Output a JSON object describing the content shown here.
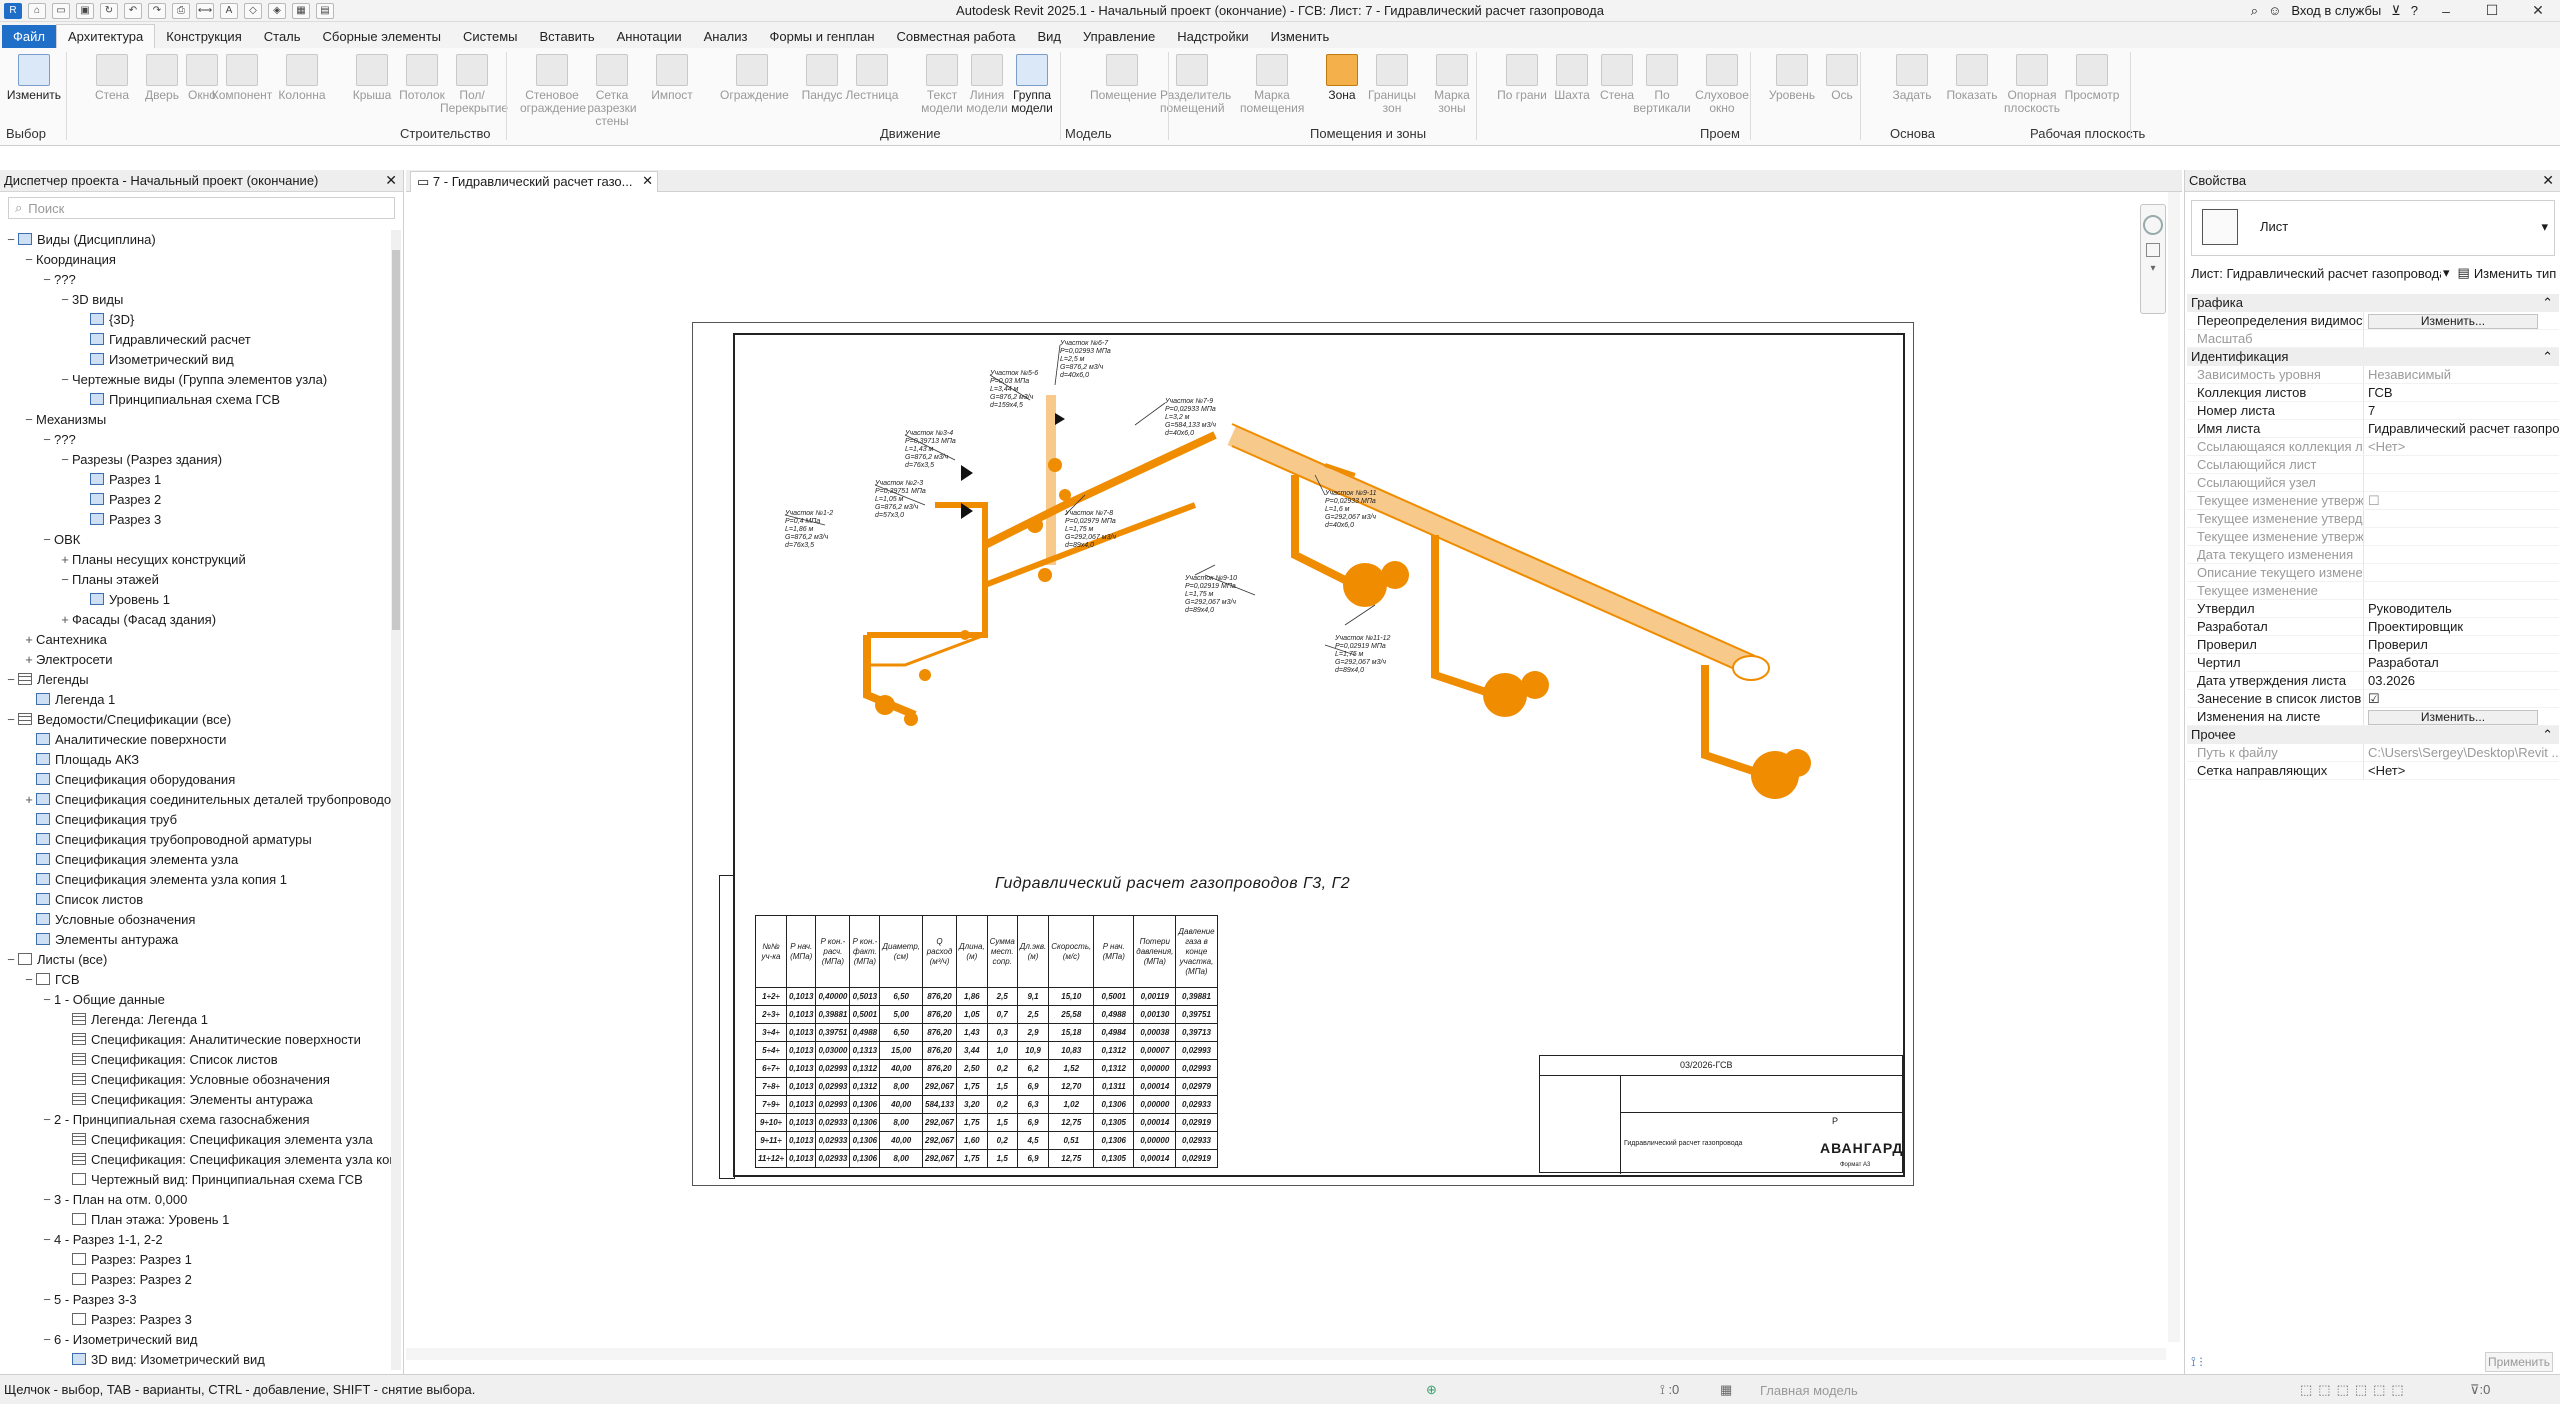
{
  "window": {
    "title": "Autodesk Revit 2025.1 - Начальный проект (окончание) - ГСВ: Лист: 7 - Гидравлический расчет газопровода"
  },
  "titlebar_right": {
    "login": "Вход в службы",
    "min": "–",
    "max": "☐",
    "close": "✕"
  },
  "tabs": [
    "Файл",
    "Архитектура",
    "Конструкция",
    "Сталь",
    "Сборные элементы",
    "Системы",
    "Вставить",
    "Аннотации",
    "Анализ",
    "Формы и генплан",
    "Совместная работа",
    "Вид",
    "Управление",
    "Надстройки",
    "Изменить"
  ],
  "ribbon": {
    "tools": [
      {
        "label": "Изменить",
        "enabled": true
      },
      {
        "label": "Стена",
        "enabled": false
      },
      {
        "label": "Дверь",
        "enabled": false
      },
      {
        "label": "Окно",
        "enabled": false
      },
      {
        "label": "Компонент",
        "enabled": false
      },
      {
        "label": "Колонна",
        "enabled": false
      },
      {
        "label": "Крыша",
        "enabled": false
      },
      {
        "label": "Потолок",
        "enabled": false
      },
      {
        "label": "Пол/Перекрытие",
        "enabled": false
      },
      {
        "label": "Стеновое ограждение",
        "enabled": false
      },
      {
        "label": "Сетка разрезки стены",
        "enabled": false
      },
      {
        "label": "Импост",
        "enabled": false
      },
      {
        "label": "Ограждение",
        "enabled": false
      },
      {
        "label": "Пандус",
        "enabled": false
      },
      {
        "label": "Лестница",
        "enabled": false
      },
      {
        "label": "Текст модели",
        "enabled": false
      },
      {
        "label": "Линия модели",
        "enabled": false
      },
      {
        "label": "Группа модели",
        "enabled": true
      },
      {
        "label": "Помещение",
        "enabled": false
      },
      {
        "label": "Разделитель помещений",
        "enabled": false
      },
      {
        "label": "Марка помещения",
        "enabled": false
      },
      {
        "label": "Зона",
        "enabled": true
      },
      {
        "label": "Границы зон",
        "enabled": false
      },
      {
        "label": "Марка зоны",
        "enabled": false
      },
      {
        "label": "По грани",
        "enabled": false
      },
      {
        "label": "Шахта",
        "enabled": false
      },
      {
        "label": "Стена",
        "enabled": false
      },
      {
        "label": "По вертикали",
        "enabled": false
      },
      {
        "label": "Слуховое окно",
        "enabled": false
      },
      {
        "label": "Уровень",
        "enabled": false
      },
      {
        "label": "Ось",
        "enabled": false
      },
      {
        "label": "Задать",
        "enabled": false
      },
      {
        "label": "Показать",
        "enabled": false
      },
      {
        "label": "Опорная плоскость",
        "enabled": false
      },
      {
        "label": "Просмотр",
        "enabled": false
      }
    ],
    "panels": [
      "Выбор",
      "Строительство",
      "Движение",
      "Модель",
      "Помещения и зоны",
      "Проем",
      "Основа",
      "Рабочая плоскость"
    ]
  },
  "project_browser": {
    "title": "Диспетчер проекта - Начальный проект (окончание)",
    "search_placeholder": "Поиск",
    "nodes": [
      {
        "t": "Виды (Дисциплина)",
        "l": 0,
        "e": "−",
        "i": "view"
      },
      {
        "t": "Координация",
        "l": 1,
        "e": "−",
        "i": ""
      },
      {
        "t": "???",
        "l": 2,
        "e": "−",
        "i": ""
      },
      {
        "t": "3D виды",
        "l": 3,
        "e": "−",
        "i": ""
      },
      {
        "t": "{3D}",
        "l": 4,
        "e": "",
        "i": "view"
      },
      {
        "t": "Гидравлический расчет",
        "l": 4,
        "e": "",
        "i": "view"
      },
      {
        "t": "Изометрический вид",
        "l": 4,
        "e": "",
        "i": "view"
      },
      {
        "t": "Чертежные виды (Группа элементов узла)",
        "l": 3,
        "e": "−",
        "i": ""
      },
      {
        "t": "Принципиальная схема ГСВ",
        "l": 4,
        "e": "",
        "i": "view"
      },
      {
        "t": "Механизмы",
        "l": 1,
        "e": "−",
        "i": ""
      },
      {
        "t": "???",
        "l": 2,
        "e": "−",
        "i": ""
      },
      {
        "t": "Разрезы (Разрез здания)",
        "l": 3,
        "e": "−",
        "i": ""
      },
      {
        "t": "Разрез 1",
        "l": 4,
        "e": "",
        "i": "view"
      },
      {
        "t": "Разрез 2",
        "l": 4,
        "e": "",
        "i": "view"
      },
      {
        "t": "Разрез 3",
        "l": 4,
        "e": "",
        "i": "view"
      },
      {
        "t": "ОВК",
        "l": 2,
        "e": "−",
        "i": ""
      },
      {
        "t": "Планы несущих конструкций",
        "l": 3,
        "e": "+",
        "i": ""
      },
      {
        "t": "Планы этажей",
        "l": 3,
        "e": "−",
        "i": ""
      },
      {
        "t": "Уровень 1",
        "l": 4,
        "e": "",
        "i": "view"
      },
      {
        "t": "Фасады (Фасад здания)",
        "l": 3,
        "e": "+",
        "i": ""
      },
      {
        "t": "Сантехника",
        "l": 1,
        "e": "+",
        "i": ""
      },
      {
        "t": "Электросети",
        "l": 1,
        "e": "+",
        "i": ""
      },
      {
        "t": "Легенды",
        "l": 0,
        "e": "−",
        "i": "tbl"
      },
      {
        "t": "Легенда 1",
        "l": 1,
        "e": "",
        "i": "view"
      },
      {
        "t": "Ведомости/Спецификации (все)",
        "l": 0,
        "e": "−",
        "i": "tbl"
      },
      {
        "t": "Аналитические поверхности",
        "l": 1,
        "e": "",
        "i": "view"
      },
      {
        "t": "Площадь АКЗ",
        "l": 1,
        "e": "",
        "i": "view"
      },
      {
        "t": "Спецификация оборудования",
        "l": 1,
        "e": "",
        "i": "view"
      },
      {
        "t": "Спецификация соединительных деталей трубопроводов",
        "l": 1,
        "e": "+",
        "i": "view"
      },
      {
        "t": "Спецификация труб",
        "l": 1,
        "e": "",
        "i": "view"
      },
      {
        "t": "Спецификация трубопроводной арматуры",
        "l": 1,
        "e": "",
        "i": "view"
      },
      {
        "t": "Спецификация элемента узла",
        "l": 1,
        "e": "",
        "i": "view"
      },
      {
        "t": "Спецификация элемента узла копия 1",
        "l": 1,
        "e": "",
        "i": "view"
      },
      {
        "t": "Список листов",
        "l": 1,
        "e": "",
        "i": "view"
      },
      {
        "t": "Условные обозначения",
        "l": 1,
        "e": "",
        "i": "view"
      },
      {
        "t": "Элементы антуража",
        "l": 1,
        "e": "",
        "i": "view"
      },
      {
        "t": "Листы (все)",
        "l": 0,
        "e": "−",
        "i": "sheet"
      },
      {
        "t": "ГСВ",
        "l": 1,
        "e": "−",
        "i": "sheet"
      },
      {
        "t": "1 - Общие данные",
        "l": 2,
        "e": "−",
        "i": ""
      },
      {
        "t": "Легенда: Легенда 1",
        "l": 3,
        "e": "",
        "i": "tbl"
      },
      {
        "t": "Спецификация: Аналитические поверхности",
        "l": 3,
        "e": "",
        "i": "tbl"
      },
      {
        "t": "Спецификация: Список листов",
        "l": 3,
        "e": "",
        "i": "tbl"
      },
      {
        "t": "Спецификация: Условные обозначения",
        "l": 3,
        "e": "",
        "i": "tbl"
      },
      {
        "t": "Спецификация: Элементы антуража",
        "l": 3,
        "e": "",
        "i": "tbl"
      },
      {
        "t": "2 - Принципиальная схема газоснабжения",
        "l": 2,
        "e": "−",
        "i": ""
      },
      {
        "t": "Спецификация: Спецификация элемента узла",
        "l": 3,
        "e": "",
        "i": "tbl"
      },
      {
        "t": "Спецификация: Спецификация элемента узла копия",
        "l": 3,
        "e": "",
        "i": "tbl"
      },
      {
        "t": "Чертежный вид: Принципиальная схема ГСВ",
        "l": 3,
        "e": "",
        "i": "sheet"
      },
      {
        "t": "3 - План на отм. 0,000",
        "l": 2,
        "e": "−",
        "i": ""
      },
      {
        "t": "План этажа: Уровень 1",
        "l": 3,
        "e": "",
        "i": "sheet"
      },
      {
        "t": "4 - Разрез 1-1, 2-2",
        "l": 2,
        "e": "−",
        "i": ""
      },
      {
        "t": "Разрез: Разрез 1",
        "l": 3,
        "e": "",
        "i": "sheet"
      },
      {
        "t": "Разрез: Разрез 2",
        "l": 3,
        "e": "",
        "i": "sheet"
      },
      {
        "t": "5 - Разрез 3-3",
        "l": 2,
        "e": "−",
        "i": ""
      },
      {
        "t": "Разрез: Разрез 3",
        "l": 3,
        "e": "",
        "i": "sheet"
      },
      {
        "t": "6 - Изометрический вид",
        "l": 2,
        "e": "−",
        "i": ""
      },
      {
        "t": "3D вид: Изометрический вид",
        "l": 3,
        "e": "",
        "i": "view"
      }
    ]
  },
  "view_tab": {
    "label": "7 - Гидравлический расчет газо..."
  },
  "drawing": {
    "title": "Гидравлический расчет газопроводов Г3, Г2",
    "table_headers": [
      "№№ уч-ка",
      "P нач. (МПа)",
      "P кон.-расч. (МПа)",
      "P кон.-факт. (МПа)",
      "Диаметр, (см)",
      "Q расход (м³/ч)",
      "Длина, (м)",
      "Сумма мест. сопр.",
      "Дл.экв. (м)",
      "Скорость, (м/с)",
      "P нач. (МПа)",
      "Потери давления, (МПа)",
      "Давление газа в конце участка, (МПа)"
    ],
    "table_rows": [
      [
        "1÷2÷",
        "0,1013",
        "0,40000",
        "0,5013",
        "6,50",
        "876,20",
        "1,86",
        "2,5",
        "9,1",
        "15,10",
        "0,5001",
        "0,00119",
        "0,39881"
      ],
      [
        "2÷3÷",
        "0,1013",
        "0,39881",
        "0,5001",
        "5,00",
        "876,20",
        "1,05",
        "0,7",
        "2,5",
        "25,58",
        "0,4988",
        "0,00130",
        "0,39751"
      ],
      [
        "3÷4÷",
        "0,1013",
        "0,39751",
        "0,4988",
        "6,50",
        "876,20",
        "1,43",
        "0,3",
        "2,9",
        "15,18",
        "0,4984",
        "0,00038",
        "0,39713"
      ],
      [
        "5÷4÷",
        "0,1013",
        "0,03000",
        "0,1313",
        "15,00",
        "876,20",
        "3,44",
        "1,0",
        "10,9",
        "10,83",
        "0,1312",
        "0,00007",
        "0,02993"
      ],
      [
        "6÷7÷",
        "0,1013",
        "0,02993",
        "0,1312",
        "40,00",
        "876,20",
        "2,50",
        "0,2",
        "6,2",
        "1,52",
        "0,1312",
        "0,00000",
        "0,02993"
      ],
      [
        "7÷8÷",
        "0,1013",
        "0,02993",
        "0,1312",
        "8,00",
        "292,067",
        "1,75",
        "1,5",
        "6,9",
        "12,70",
        "0,1311",
        "0,00014",
        "0,02979"
      ],
      [
        "7÷9÷",
        "0,1013",
        "0,02993",
        "0,1306",
        "40,00",
        "584,133",
        "3,20",
        "0,2",
        "6,3",
        "1,02",
        "0,1306",
        "0,00000",
        "0,02933"
      ],
      [
        "9÷10÷",
        "0,1013",
        "0,02933",
        "0,1306",
        "8,00",
        "292,067",
        "1,75",
        "1,5",
        "6,9",
        "12,75",
        "0,1305",
        "0,00014",
        "0,02919"
      ],
      [
        "9÷11÷",
        "0,1013",
        "0,02933",
        "0,1306",
        "40,00",
        "292,067",
        "1,60",
        "0,2",
        "4,5",
        "0,51",
        "0,1306",
        "0,00000",
        "0,02933"
      ],
      [
        "11÷12÷",
        "0,1013",
        "0,02933",
        "0,1306",
        "8,00",
        "292,067",
        "1,75",
        "1,5",
        "6,9",
        "12,75",
        "0,1305",
        "0,00014",
        "0,02919"
      ]
    ],
    "title_block": {
      "code": "03/2026-ГСВ",
      "sheet_name": "Гидравлический расчет газопровода",
      "stage": "Р",
      "company": "АВАНГАРД",
      "format": "Формат А3"
    },
    "pipe_labels": [
      {
        "t": "Участок №6-7",
        "s": "P=0,02993 МПа; L=2,5 м; G=876,2 м3/ч; d=40х6,0"
      },
      {
        "t": "Участок №5-6",
        "s": "P=0,03 МПа; L=3,44 м; G=876,2 м3/ч; d=159х4,5"
      },
      {
        "t": "Участок №7-9",
        "s": "P=0,02933 МПа; L=3,2 м; G=584,133 м3/ч; d=40х6,0"
      },
      {
        "t": "Участок №3-4",
        "s": "P=0,39713 МПа; L=1,43 м; G=876,2 м3/ч; d=76х3,5"
      },
      {
        "t": "Участок №2-3",
        "s": "P=0,39751 МПа; L=1,05 м; G=876,2 м3/ч; d=57х3,0"
      },
      {
        "t": "Участок №7-8",
        "s": "P=0,02979 МПа; L=1,75 м; G=292,067 м3/ч; d=89х4,0"
      },
      {
        "t": "Участок №1-2",
        "s": "P=0,4 МПа; L=1,86 м; G=876,2 м3/ч; d=76х3,5"
      },
      {
        "t": "Участок №9-11",
        "s": "P=0,02933 МПа; L=1,6 м; G=292,067 м3/ч; d=40х6,0"
      },
      {
        "t": "Участок №9-10",
        "s": "P=0,02919 МПа; L=1,75 м; G=292,067 м3/ч; d=89х4,0"
      },
      {
        "t": "Участок №11-12",
        "s": "P=0,02919 МПа; L=1,75 м; G=292,067 м3/ч; d=89х4,0"
      }
    ]
  },
  "properties": {
    "title": "Свойства",
    "type_name": "Лист",
    "selector": "Лист: Гидравлический расчет газопровода",
    "edit_type": "Изменить тип",
    "categories": [
      {
        "name": "Графика",
        "rows": [
          {
            "k": "Переопределения видимости...",
            "v": "Изменить...",
            "btn": true
          },
          {
            "k": "Масштаб",
            "v": "",
            "dis": true
          }
        ]
      },
      {
        "name": "Идентификация",
        "rows": [
          {
            "k": "Зависимость уровня",
            "v": "Независимый",
            "dis": true
          },
          {
            "k": "Коллекция листов",
            "v": "ГСВ"
          },
          {
            "k": "Номер листа",
            "v": "7"
          },
          {
            "k": "Имя листа",
            "v": "Гидравлический расчет газопро..."
          },
          {
            "k": "Ссылающаяся коллекция ли...",
            "v": "<Нет>",
            "dis": true
          },
          {
            "k": "Ссылающийся лист",
            "v": "",
            "dis": true
          },
          {
            "k": "Ссылающийся узел",
            "v": "",
            "dis": true
          },
          {
            "k": "Текущее изменение утвержд...",
            "v": "☐",
            "dis": true
          },
          {
            "k": "Текущее изменение утвердил",
            "v": "",
            "dis": true
          },
          {
            "k": "Текущее изменение утвержд...",
            "v": "",
            "dis": true
          },
          {
            "k": "Дата текущего изменения",
            "v": "",
            "dis": true
          },
          {
            "k": "Описание текущего изменения",
            "v": "",
            "dis": true
          },
          {
            "k": "Текущее изменение",
            "v": "",
            "dis": true
          },
          {
            "k": "Утвердил",
            "v": "Руководитель"
          },
          {
            "k": "Разработал",
            "v": "Проектировщик"
          },
          {
            "k": "Проверил",
            "v": "Проверил"
          },
          {
            "k": "Чертил",
            "v": "Разработал"
          },
          {
            "k": "Дата утверждения листа",
            "v": "03.2026"
          },
          {
            "k": "Занесение в список листов",
            "v": "☑"
          },
          {
            "k": "Изменения на листе",
            "v": "Изменить...",
            "btn": true
          }
        ]
      },
      {
        "name": "Прочее",
        "rows": [
          {
            "k": "Путь к файлу",
            "v": "C:\\Users\\Sergey\\Desktop\\Revit ...",
            "dis": true
          },
          {
            "k": "Сетка направляющих",
            "v": "<Нет>"
          }
        ]
      }
    ],
    "apply": "Применить"
  },
  "status": {
    "message": "Щелчок - выбор, TAB - варианты, CTRL - добавление, SHIFT - снятие выбора.",
    "model": "Главная модель"
  },
  "colors": {
    "accent": "#1f6fc9",
    "pipe": "#f08c00"
  }
}
